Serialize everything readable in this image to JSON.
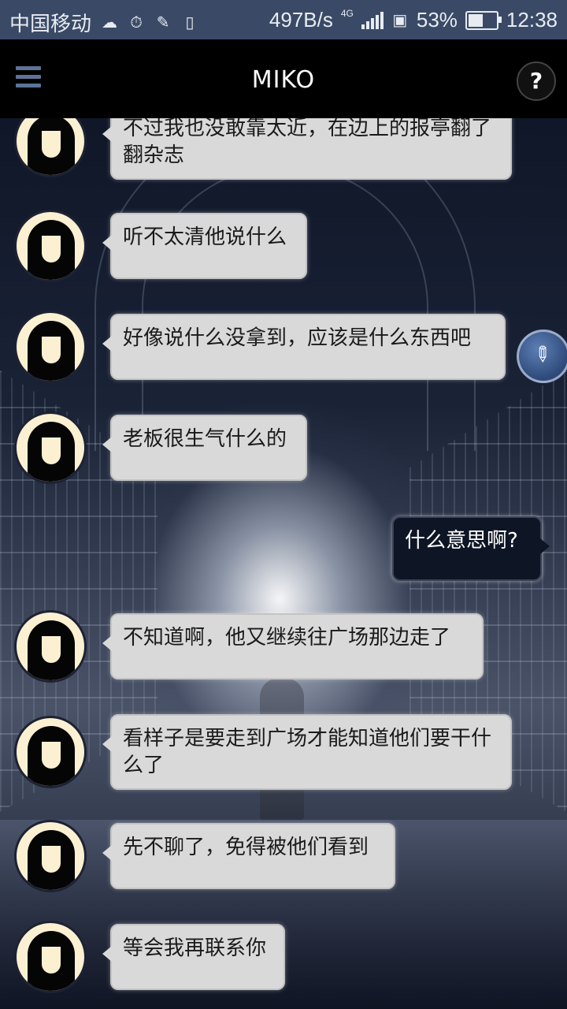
{
  "status_bar": {
    "carrier": "中国移动",
    "speed": "497B/s",
    "network": "4G",
    "battery": "53%",
    "battery_level": 0.53,
    "time": "12:38"
  },
  "app_bar": {
    "title": "MIKO",
    "help_label": "?"
  },
  "messages": [
    {
      "from": "contact",
      "text": "不过我也没敢靠太近，在边上的报亭翻了翻杂志"
    },
    {
      "from": "contact",
      "text": "听不太清他说什么"
    },
    {
      "from": "contact",
      "text": "好像说什么没拿到，应该是什么东西吧"
    },
    {
      "from": "contact",
      "text": "老板很生气什么的"
    },
    {
      "from": "me",
      "text": "什么意思啊?"
    },
    {
      "from": "contact",
      "text": "不知道啊，他又继续往广场那边走了"
    },
    {
      "from": "contact",
      "text": "看样子是要走到广场才能知道他们要干什么了"
    },
    {
      "from": "contact",
      "text": "先不聊了，免得被他们看到"
    },
    {
      "from": "contact",
      "text": "等会我再联系你"
    }
  ],
  "icons": {
    "menu": "hamburger-menu-icon",
    "help": "question-mark-icon",
    "float": "pencil-icon"
  },
  "colors": {
    "status_bar": "#3a4a66",
    "app_bar": "#000000",
    "incoming_bubble": "#d9d9d9",
    "outgoing_bubble": "#0e1524",
    "avatar_bg": "#fbf1d2"
  }
}
